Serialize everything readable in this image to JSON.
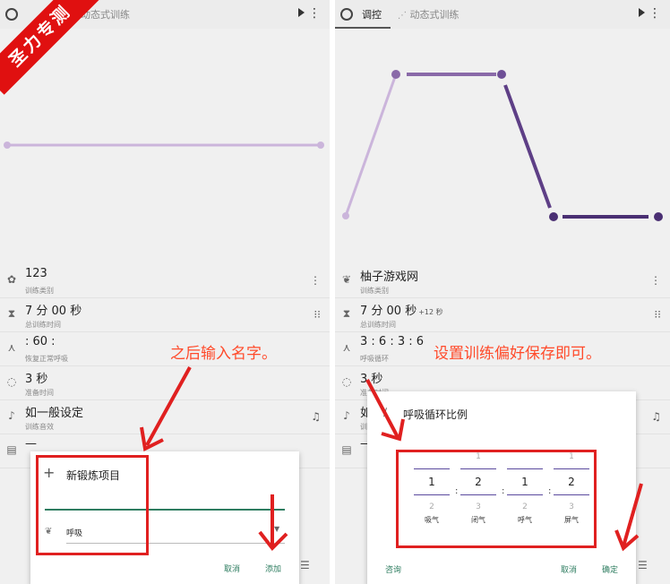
{
  "watermark": "圣力专测",
  "left": {
    "toolbar": {
      "tab_dynamic": "动态式训练"
    },
    "rows": [
      {
        "icon": "lotus-icon",
        "main": "123",
        "sub": "训练类别",
        "side": "⋮"
      },
      {
        "icon": "hourglass-icon",
        "main": "7 分 00 秒",
        "sub": "总训练时间",
        "side": "⁝⁝"
      },
      {
        "icon": "breath-icon",
        "main": " : 60 :",
        "sub": "恢复正常呼吸",
        "side": ""
      },
      {
        "icon": "timer-icon",
        "main": "3 秒",
        "sub": "准备时间",
        "side": ""
      },
      {
        "icon": "music-icon",
        "main": "如一般设定",
        "sub": "训练音效",
        "side": "♫"
      },
      {
        "icon": "doc-icon",
        "main": "—",
        "sub": "",
        "side": ""
      }
    ],
    "dialog": {
      "title": "新锻炼项目",
      "input_value": "",
      "select_value": "呼吸",
      "cancel": "取消",
      "add": "添加"
    },
    "annotation": "之后输入名字。"
  },
  "right": {
    "toolbar": {
      "tab_control": "调控",
      "tab_dynamic": "动态式训练"
    },
    "rows": [
      {
        "icon": "lungs-icon",
        "main": "柚子游戏网",
        "sub": "训练类别",
        "extra": "",
        "side": "⋮"
      },
      {
        "icon": "hourglass-icon",
        "main": "7 分 00 秒",
        "sub": "总训练时间",
        "extra": "+12 秒",
        "side": "⁝⁝"
      },
      {
        "icon": "breath-icon",
        "main": "3 : 6 : 3 : 6",
        "sub": "呼吸循环",
        "extra": "",
        "side": ""
      },
      {
        "icon": "timer-icon",
        "main": "3 秒",
        "sub": "准备时间",
        "extra": "",
        "side": ""
      },
      {
        "icon": "music-icon",
        "main": "如",
        "sub": "训练",
        "extra": "",
        "side": "♫"
      },
      {
        "icon": "doc-icon",
        "main": "—",
        "sub": "",
        "extra": "",
        "side": ""
      }
    ],
    "dialog": {
      "title": "呼吸循环比例",
      "columns": [
        {
          "top": "",
          "value": "1",
          "bottom": "2",
          "label": "吸气"
        },
        {
          "top": "1",
          "value": "2",
          "bottom": "3",
          "label": "闭气"
        },
        {
          "top": "",
          "value": "1",
          "bottom": "2",
          "label": "呼气"
        },
        {
          "top": "1",
          "value": "2",
          "bottom": "3",
          "label": "屏气"
        }
      ],
      "consult": "咨询",
      "cancel": "取消",
      "ok": "确定"
    },
    "annotation": "设置训练偏好保存即可。"
  },
  "colors": {
    "chart_light": "#cbb5db",
    "chart_dark": "#4a2f73",
    "red": "#e02020",
    "accent_green": "#2e7d60"
  }
}
